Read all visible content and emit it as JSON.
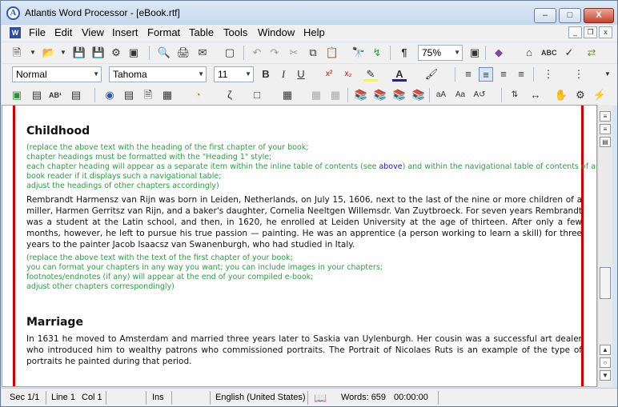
{
  "window": {
    "title": "Atlantis Word Processor - [eBook.rtf]",
    "logo_letter": "A",
    "controls": {
      "minimize": "–",
      "maximize": "□",
      "close": "X"
    }
  },
  "menu": {
    "items": [
      "File",
      "Edit",
      "View",
      "Insert",
      "Format",
      "Table",
      "Tools",
      "Window",
      "Help"
    ],
    "doc_controls": {
      "minimize": "_",
      "restore": "❐",
      "close": "x"
    }
  },
  "toolbar": {
    "zoom": "75%",
    "style": "Normal",
    "font": "Tahoma",
    "size": "11",
    "bold": "B",
    "italic": "I",
    "underline": "U",
    "superscript": "x²",
    "subscript": "x₂",
    "paragraph_mark": "¶",
    "abc_label": "AB¹"
  },
  "document": {
    "sections": [
      {
        "heading": "Childhood",
        "note_lines": [
          "(replace the above text with the heading of the first chapter of your book;",
          "chapter headings must be formatted with the \"Heading 1\" style;",
          "each chapter heading will appear as a separate item within the inline table of contents (see ",
          "book reader if it displays such a navigational table;",
          "adjust the headings of other chapters accordingly)"
        ],
        "link_text": "above",
        "line3_tail": ") and within the navigational table of contents of an e-",
        "body": "Rembrandt Harmensz van Rijn was born in Leiden, Netherlands, on July 15, 1606, next to the last of the nine or more children of a miller, Harmen Gerritsz van Rijn, and a baker's daughter, Cornelia Neeltgen Willemsdr. Van Zuytbroeck. For seven years Rembrandt was a student at the Latin school, and then, in 1620, he enrolled at Leiden University at the age of thirteen. After only a few months, however, he left to pursue his true passion — painting. He was an apprentice (a person working to learn a skill) for three years to the painter Jacob Isaacsz van Swanenburgh, who had studied in Italy.",
        "note2_lines": [
          "(replace the above text with the text of the first chapter of your book;",
          "you can format your chapters in any way you want; you can include images in your chapters;",
          "footnotes/endnotes (if any) will appear at the end of your compiled e-book;",
          "adjust other chapters correspondingly)"
        ]
      },
      {
        "heading": "Marriage",
        "body": "In 1631 he moved to Amsterdam and married three years later to Saskia van Uylenburgh. Her cousin was a successful art dealer who introduced him to wealthy patrons who commissioned portraits. The Portrait of Nicolaes Ruts is an example of the type of portraits he painted during that period."
      }
    ]
  },
  "status": {
    "section": "Sec 1/1",
    "line": "Line 1",
    "col": "Col 1",
    "mode": "Ins",
    "language": "English (United States)",
    "words": "Words: 659",
    "time": "00:00:00"
  }
}
